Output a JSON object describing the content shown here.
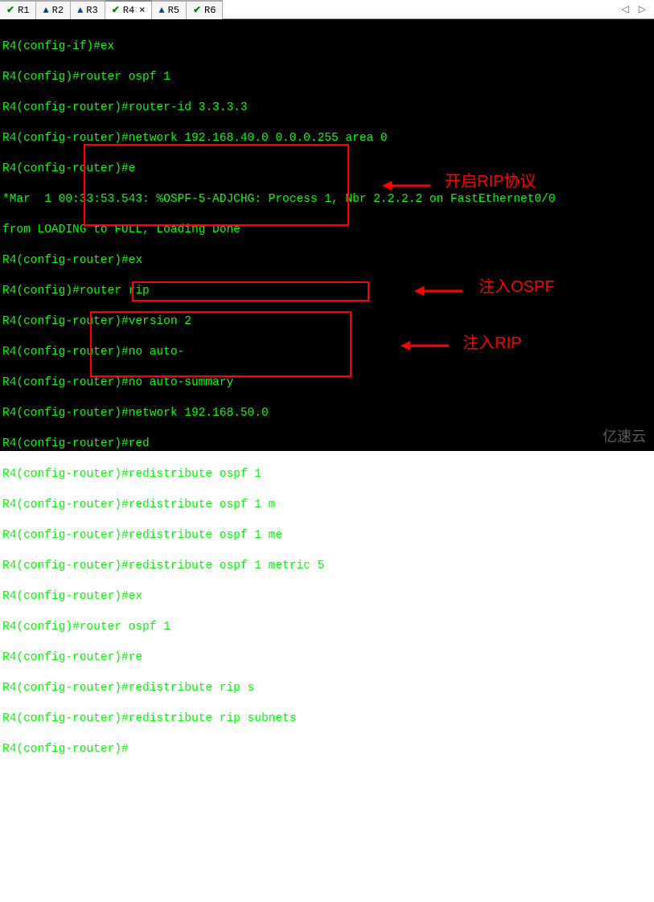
{
  "tabs": [
    {
      "label": "R1",
      "iconType": "check",
      "active": false
    },
    {
      "label": "R2",
      "iconType": "warn",
      "active": false
    },
    {
      "label": "R3",
      "iconType": "warn",
      "active": false
    },
    {
      "label": "R4",
      "iconType": "check",
      "active": true
    },
    {
      "label": "R5",
      "iconType": "warn",
      "active": false
    },
    {
      "label": "R6",
      "iconType": "check",
      "active": false
    }
  ],
  "terminal_lines": [
    "R4(config-if)#ex",
    "R4(config)#router ospf 1",
    "R4(config-router)#router-id 3.3.3.3",
    "R4(config-router)#network 192.168.40.0 0.0.0.255 area 0",
    "R4(config-router)#e",
    "*Mar  1 00:33:53.543: %OSPF-5-ADJCHG: Process 1, Nbr 2.2.2.2 on FastEthernet0/0",
    "from LOADING to FULL, Loading Done",
    "R4(config-router)#ex",
    "R4(config)#router rip",
    "R4(config-router)#version 2",
    "R4(config-router)#no auto-",
    "R4(config-router)#no auto-summary",
    "R4(config-router)#network 192.168.50.0",
    "R4(config-router)#red",
    "R4(config-router)#redistribute ospf 1",
    "R4(config-router)#redistribute ospf 1 m",
    "R4(config-router)#redistribute ospf 1 me",
    "R4(config-router)#redistribute ospf 1 metric 5",
    "R4(config-router)#ex",
    "R4(config)#router ospf 1",
    "R4(config-router)#re",
    "R4(config-router)#redistribute rip s",
    "R4(config-router)#redistribute rip subnets",
    "R4(config-router)#"
  ],
  "annotations": {
    "box1_label": "开启RIP协议",
    "box2_label": "注入OSPF",
    "box3_label": "注入RIP"
  },
  "watermark": "亿速云",
  "scroll_left": "◁",
  "scroll_right": "▷",
  "close_x": "×"
}
